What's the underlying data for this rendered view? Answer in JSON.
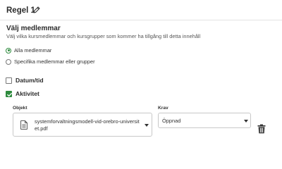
{
  "rule": {
    "title": "Regel 1",
    "edit_icon": "pencil-icon"
  },
  "members": {
    "title": "Välj medlemmar",
    "description": "Välj vilka kursmedlemmar och kursgrupper som kommer ha tillgång till detta innehåll",
    "options": [
      {
        "label": "Alla medlemmar",
        "selected": true
      },
      {
        "label": "Specifika medlemmar eller grupper",
        "selected": false
      }
    ]
  },
  "conditions": {
    "date_time": {
      "label": "Datum/tid",
      "checked": false
    },
    "activity": {
      "label": "Aktivitet",
      "checked": true
    }
  },
  "activity_fields": {
    "object_label": "Objekt",
    "object_value": "systemforvaltningsmodell-vid-orebro-universitet.pdf",
    "object_icon": "document-icon",
    "requirement_label": "Krav",
    "requirement_value": "Öppnad",
    "delete_icon": "trash-icon"
  },
  "colors": {
    "accent": "#2e8b3e",
    "border": "#c8c8c8",
    "text": "#333333"
  }
}
